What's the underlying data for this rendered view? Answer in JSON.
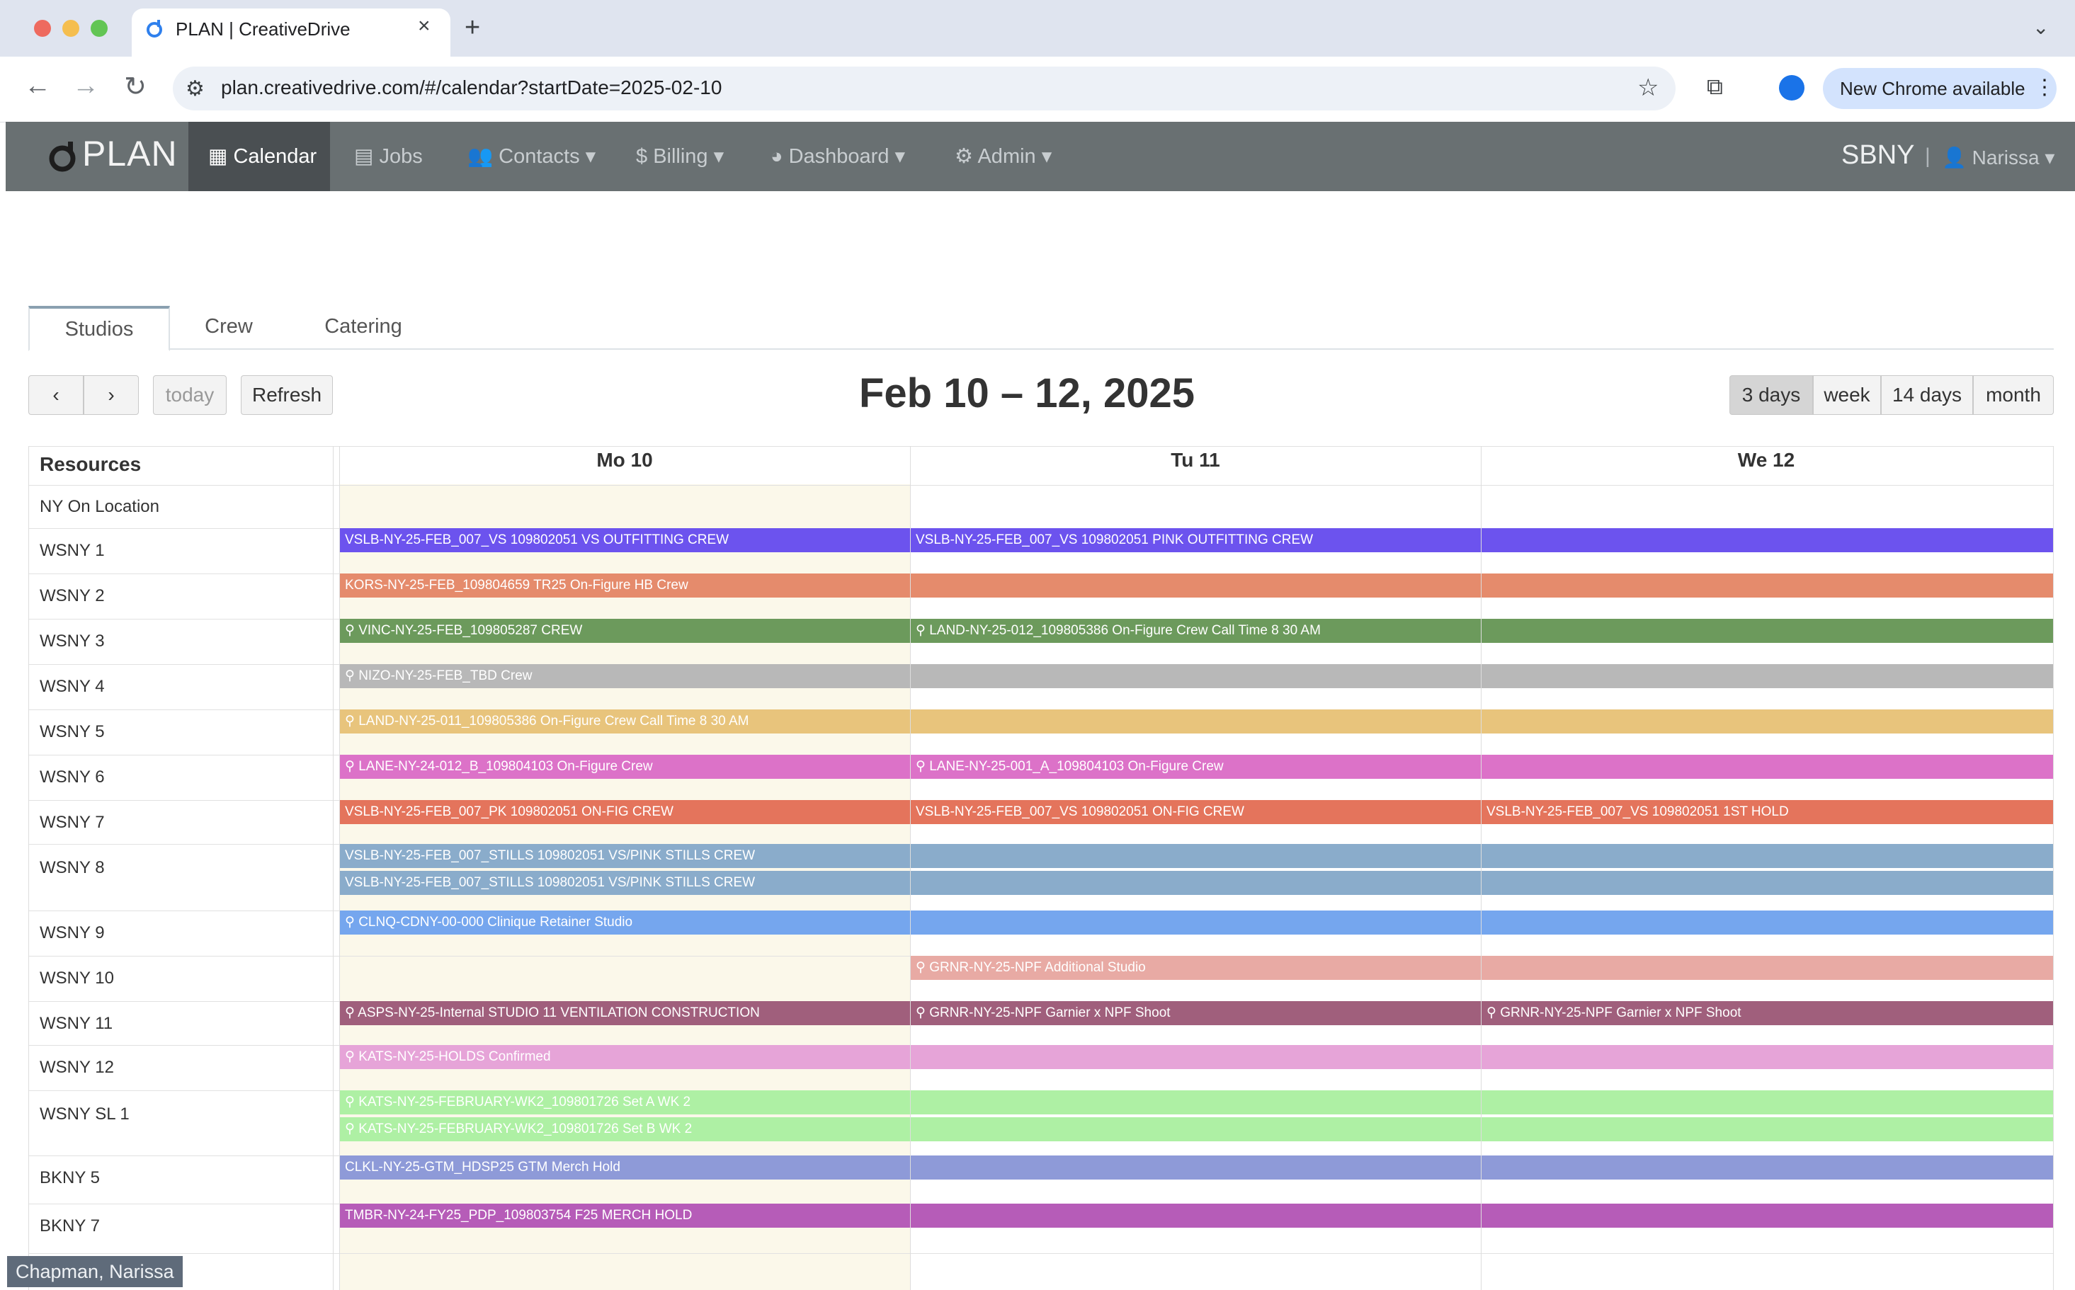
{
  "browser": {
    "tab_title": "PLAN | CreativeDrive",
    "url": "plan.creativedrive.com/#/calendar?startDate=2025-02-10",
    "new_chrome_label": "New Chrome available"
  },
  "app": {
    "brand": "PLAN",
    "nav": [
      {
        "label": "Calendar",
        "icon": "calendar-icon"
      },
      {
        "label": "Jobs",
        "icon": "list-icon"
      },
      {
        "label": "Contacts",
        "icon": "users-icon"
      },
      {
        "label": "Billing",
        "icon": "dollar-icon"
      },
      {
        "label": "Dashboard",
        "icon": "pie-chart-icon"
      },
      {
        "label": "Admin",
        "icon": "gear-icon"
      }
    ],
    "org": "SBNY",
    "user": "Narissa"
  },
  "resource_tabs": [
    "Studios",
    "Crew",
    "Catering"
  ],
  "toolbar": {
    "today": "today",
    "refresh": "Refresh",
    "title": "Feb 10 – 12, 2025",
    "views": [
      "3 days",
      "week",
      "14 days",
      "month"
    ],
    "active_view": "3 days"
  },
  "grid": {
    "resources_header": "Resources",
    "days": [
      "Mo 10",
      "Tu 11",
      "We 12"
    ],
    "resources": [
      "NY On Location",
      "WSNY 1",
      "WSNY 2",
      "WSNY 3",
      "WSNY 4",
      "WSNY 5",
      "WSNY 6",
      "WSNY 7",
      "WSNY 8",
      "WSNY 9",
      "WSNY 10",
      "WSNY 11",
      "WSNY 12",
      "WSNY SL 1",
      "BKNY 5",
      "BKNY 7"
    ],
    "events": [
      {
        "row": 1,
        "text": "VSLB-NY-25-FEB_007_VS 109802051 VS OUTFITTING CREW",
        "start": 0,
        "end": 1,
        "color": "#6c53ee"
      },
      {
        "row": 1,
        "text": "VSLB-NY-25-FEB_007_VS 109802051 PINK OUTFITTING CREW",
        "start": 1,
        "end": 3,
        "color": "#6c53ee"
      },
      {
        "row": 2,
        "text": "KORS-NY-25-FEB_109804659 TR25 On-Figure HB Crew",
        "start": 0,
        "end": 3,
        "color": "#e58b6c"
      },
      {
        "row": 3,
        "text": "VINC-NY-25-FEB_109805287 CREW",
        "start": 0,
        "end": 1,
        "color": "#6c9a5c",
        "pin": true
      },
      {
        "row": 3,
        "text": "LAND-NY-25-012_109805386 On-Figure Crew Call Time 8 30 AM",
        "start": 1,
        "end": 3,
        "color": "#6c9a5c",
        "pin": true
      },
      {
        "row": 4,
        "text": "NIZO-NY-25-FEB_TBD Crew",
        "start": 0,
        "end": 3,
        "color": "#b8b8b8",
        "pin": true
      },
      {
        "row": 5,
        "text": "LAND-NY-25-011_109805386 On-Figure Crew Call Time 8 30 AM",
        "start": 0,
        "end": 3,
        "color": "#e8c47c",
        "pin": true
      },
      {
        "row": 6,
        "text": "LANE-NY-24-012_B_109804103 On-Figure Crew",
        "start": 0,
        "end": 1,
        "color": "#dc72c8",
        "pin": true
      },
      {
        "row": 6,
        "text": "LANE-NY-25-001_A_109804103 On-Figure Crew",
        "start": 1,
        "end": 3,
        "color": "#dc72c8",
        "pin": true
      },
      {
        "row": 7,
        "text": "VSLB-NY-25-FEB_007_PK 109802051 ON-FIG CREW",
        "start": 0,
        "end": 1,
        "color": "#e4745c"
      },
      {
        "row": 7,
        "text": "VSLB-NY-25-FEB_007_VS 109802051 ON-FIG CREW",
        "start": 1,
        "end": 2,
        "color": "#e4745c"
      },
      {
        "row": 7,
        "text": "VSLB-NY-25-FEB_007_VS 109802051 1ST HOLD",
        "start": 2,
        "end": 3,
        "color": "#e4745c"
      },
      {
        "row": 8,
        "text": "VSLB-NY-25-FEB_007_STILLS 109802051 VS/PINK STILLS CREW",
        "start": 0,
        "end": 3,
        "color": "#8aaccb",
        "sub": 0
      },
      {
        "row": 8,
        "text": "VSLB-NY-25-FEB_007_STILLS 109802051 VS/PINK STILLS CREW",
        "start": 0,
        "end": 3,
        "color": "#8aaccb",
        "sub": 1
      },
      {
        "row": 9,
        "text": "CLNQ-CDNY-00-000 Clinique Retainer Studio",
        "start": 0,
        "end": 3,
        "color": "#75a6ee",
        "pin": true
      },
      {
        "row": 10,
        "text": "GRNR-NY-25-NPF Additional Studio",
        "start": 1,
        "end": 3,
        "color": "#e8aaa4",
        "pin": true
      },
      {
        "row": 11,
        "text": "ASPS-NY-25-Internal STUDIO 11 VENTILATION CONSTRUCTION",
        "start": 0,
        "end": 1,
        "color": "#a05f7c",
        "pin": true
      },
      {
        "row": 11,
        "text": "GRNR-NY-25-NPF Garnier x NPF Shoot",
        "start": 1,
        "end": 2,
        "color": "#a05f7c",
        "pin": true
      },
      {
        "row": 11,
        "text": "GRNR-NY-25-NPF Garnier x NPF Shoot",
        "start": 2,
        "end": 3,
        "color": "#a05f7c",
        "pin": true
      },
      {
        "row": 12,
        "text": "KATS-NY-25-HOLDS Confirmed",
        "start": 0,
        "end": 3,
        "color": "#e6a4d8",
        "pin": true
      },
      {
        "row": 13,
        "text": "KATS-NY-25-FEBRUARY-WK2_109801726 Set A WK 2",
        "start": 0,
        "end": 3,
        "color": "#aef0a4",
        "pin": true,
        "sub": 0
      },
      {
        "row": 13,
        "text": "KATS-NY-25-FEBRUARY-WK2_109801726 Set B WK 2",
        "start": 0,
        "end": 3,
        "color": "#aef0a4",
        "pin": true,
        "sub": 1
      },
      {
        "row": 14,
        "text": "CLKL-NY-25-GTM_HDSP25 GTM Merch Hold",
        "start": 0,
        "end": 3,
        "color": "#8e9ad8"
      },
      {
        "row": 15,
        "text": "TMBR-NY-24-FY25_PDP_109803754 F25 MERCH HOLD",
        "start": 0,
        "end": 3,
        "color": "#b65cb8"
      }
    ]
  },
  "footer": {
    "user_badge": "Chapman, Narissa"
  },
  "colors": {
    "navbar": "#697072",
    "navbar_active": "#4a4f52",
    "today_highlight": "#fbf8ea"
  }
}
